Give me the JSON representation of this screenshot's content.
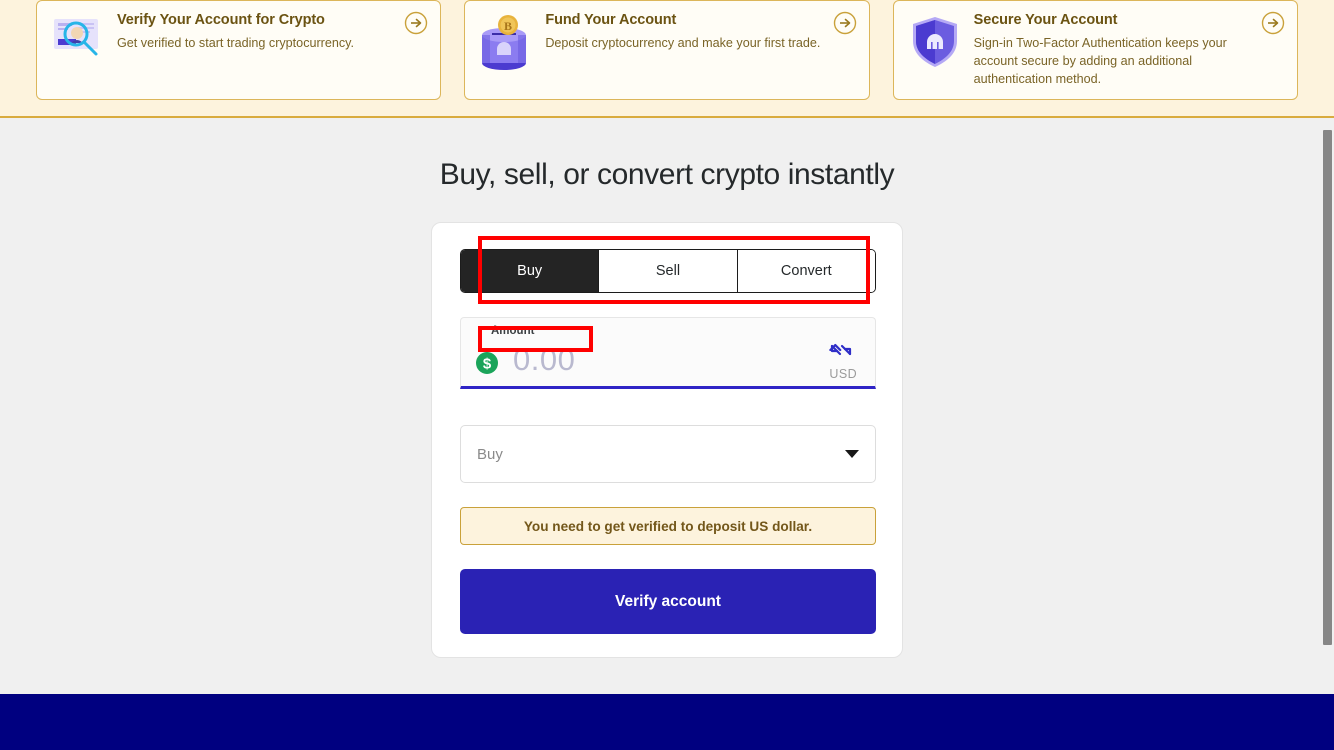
{
  "onboarding": {
    "cards": [
      {
        "title": "Verify Your Account for Crypto",
        "description": "Get verified to start trading cryptocurrency.",
        "icon": "id-card-magnifier-icon",
        "arrow": "arrow-right-circle-icon"
      },
      {
        "title": "Fund Your Account",
        "description": "Deposit cryptocurrency and make your first trade.",
        "icon": "bitcoin-coin-vault-icon",
        "arrow": "arrow-right-circle-icon"
      },
      {
        "title": "Secure Your Account",
        "description": "Sign-in Two-Factor Authentication keeps your account secure by adding an additional authentication method.",
        "icon": "shield-kraken-icon",
        "arrow": "arrow-right-circle-icon"
      }
    ]
  },
  "main": {
    "heading": "Buy, sell, or convert crypto instantly",
    "tabs": [
      {
        "label": "Buy",
        "active": true
      },
      {
        "label": "Sell",
        "active": false
      },
      {
        "label": "Convert",
        "active": false
      }
    ],
    "amount": {
      "label": "Amount",
      "value": "0.00",
      "currency": "USD",
      "currency_icon": "usd-green-dollar-icon",
      "swap_icon": "swap-arrows-icon"
    },
    "asset_select": {
      "value": "Buy",
      "chevron_icon": "chevron-down-icon"
    },
    "notice": "You need to get verified to deposit US dollar.",
    "cta_label": "Verify account"
  },
  "colors": {
    "banner_bg": "#fdf3dd",
    "banner_border": "#d9ab3e",
    "card_bg": "#fffdf6",
    "page_bg": "#f0f0f0",
    "tab_active_bg": "#242424",
    "accent_indigo": "#2a22b4",
    "amount_underline": "#2f24c6",
    "notice_text": "#73571a",
    "footer_navy": "#000080",
    "annotation_red": "#ff0000",
    "dollar_green": "#1ba45a"
  }
}
